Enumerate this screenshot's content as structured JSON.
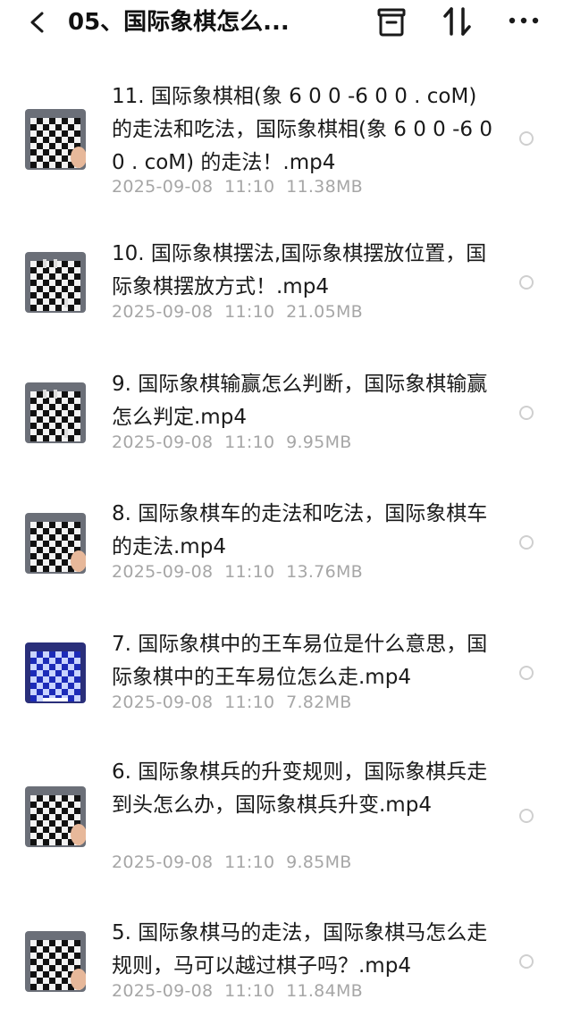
{
  "header": {
    "title": "05、国际象棋怎么..."
  },
  "colors": {
    "meta_text": "#a6a6a6",
    "radio_border": "#cfcfcf"
  },
  "files": [
    {
      "name": "11. 国际象棋相(象 6 0 0 -6 0 0 . coM) 的走法和吃法，国际象棋相(象 6 0 0 -6 0 0 . coM) 的走法！.mp4",
      "date": "2025-09-08",
      "time": "11:10",
      "size": "11.38MB",
      "thumb_style": "board-hand"
    },
    {
      "name": "10. 国际象棋摆法,国际象棋摆放位置，国际象棋摆放方式！.mp4",
      "date": "2025-09-08",
      "time": "11:10",
      "size": "21.05MB",
      "thumb_style": "board-pieces"
    },
    {
      "name": "9. 国际象棋输赢怎么判断，国际象棋输赢怎么判定.mp4",
      "date": "2025-09-08",
      "time": "11:10",
      "size": "9.95MB",
      "thumb_style": "board-pieces"
    },
    {
      "name": "8. 国际象棋车的走法和吃法，国际象棋车的走法.mp4",
      "date": "2025-09-08",
      "time": "11:10",
      "size": "13.76MB",
      "thumb_style": "board-hand"
    },
    {
      "name": "7. 国际象棋中的王车易位是什么意思，国际象棋中的王车易位怎么走.mp4",
      "date": "2025-09-08",
      "time": "11:10",
      "size": "7.82MB",
      "thumb_style": "board-blue"
    },
    {
      "name": "6. 国际象棋兵的升变规则，国际象棋兵走到头怎么办，国际象棋兵升变.mp4",
      "date": "2025-09-08",
      "time": "11:10",
      "size": "9.85MB",
      "thumb_style": "board-hand"
    },
    {
      "name": "5. 国际象棋马的走法，国际象棋马怎么走规则，马可以越过棋子吗？.mp4",
      "date": "2025-09-08",
      "time": "11:10",
      "size": "11.84MB",
      "thumb_style": "board-hand"
    }
  ]
}
